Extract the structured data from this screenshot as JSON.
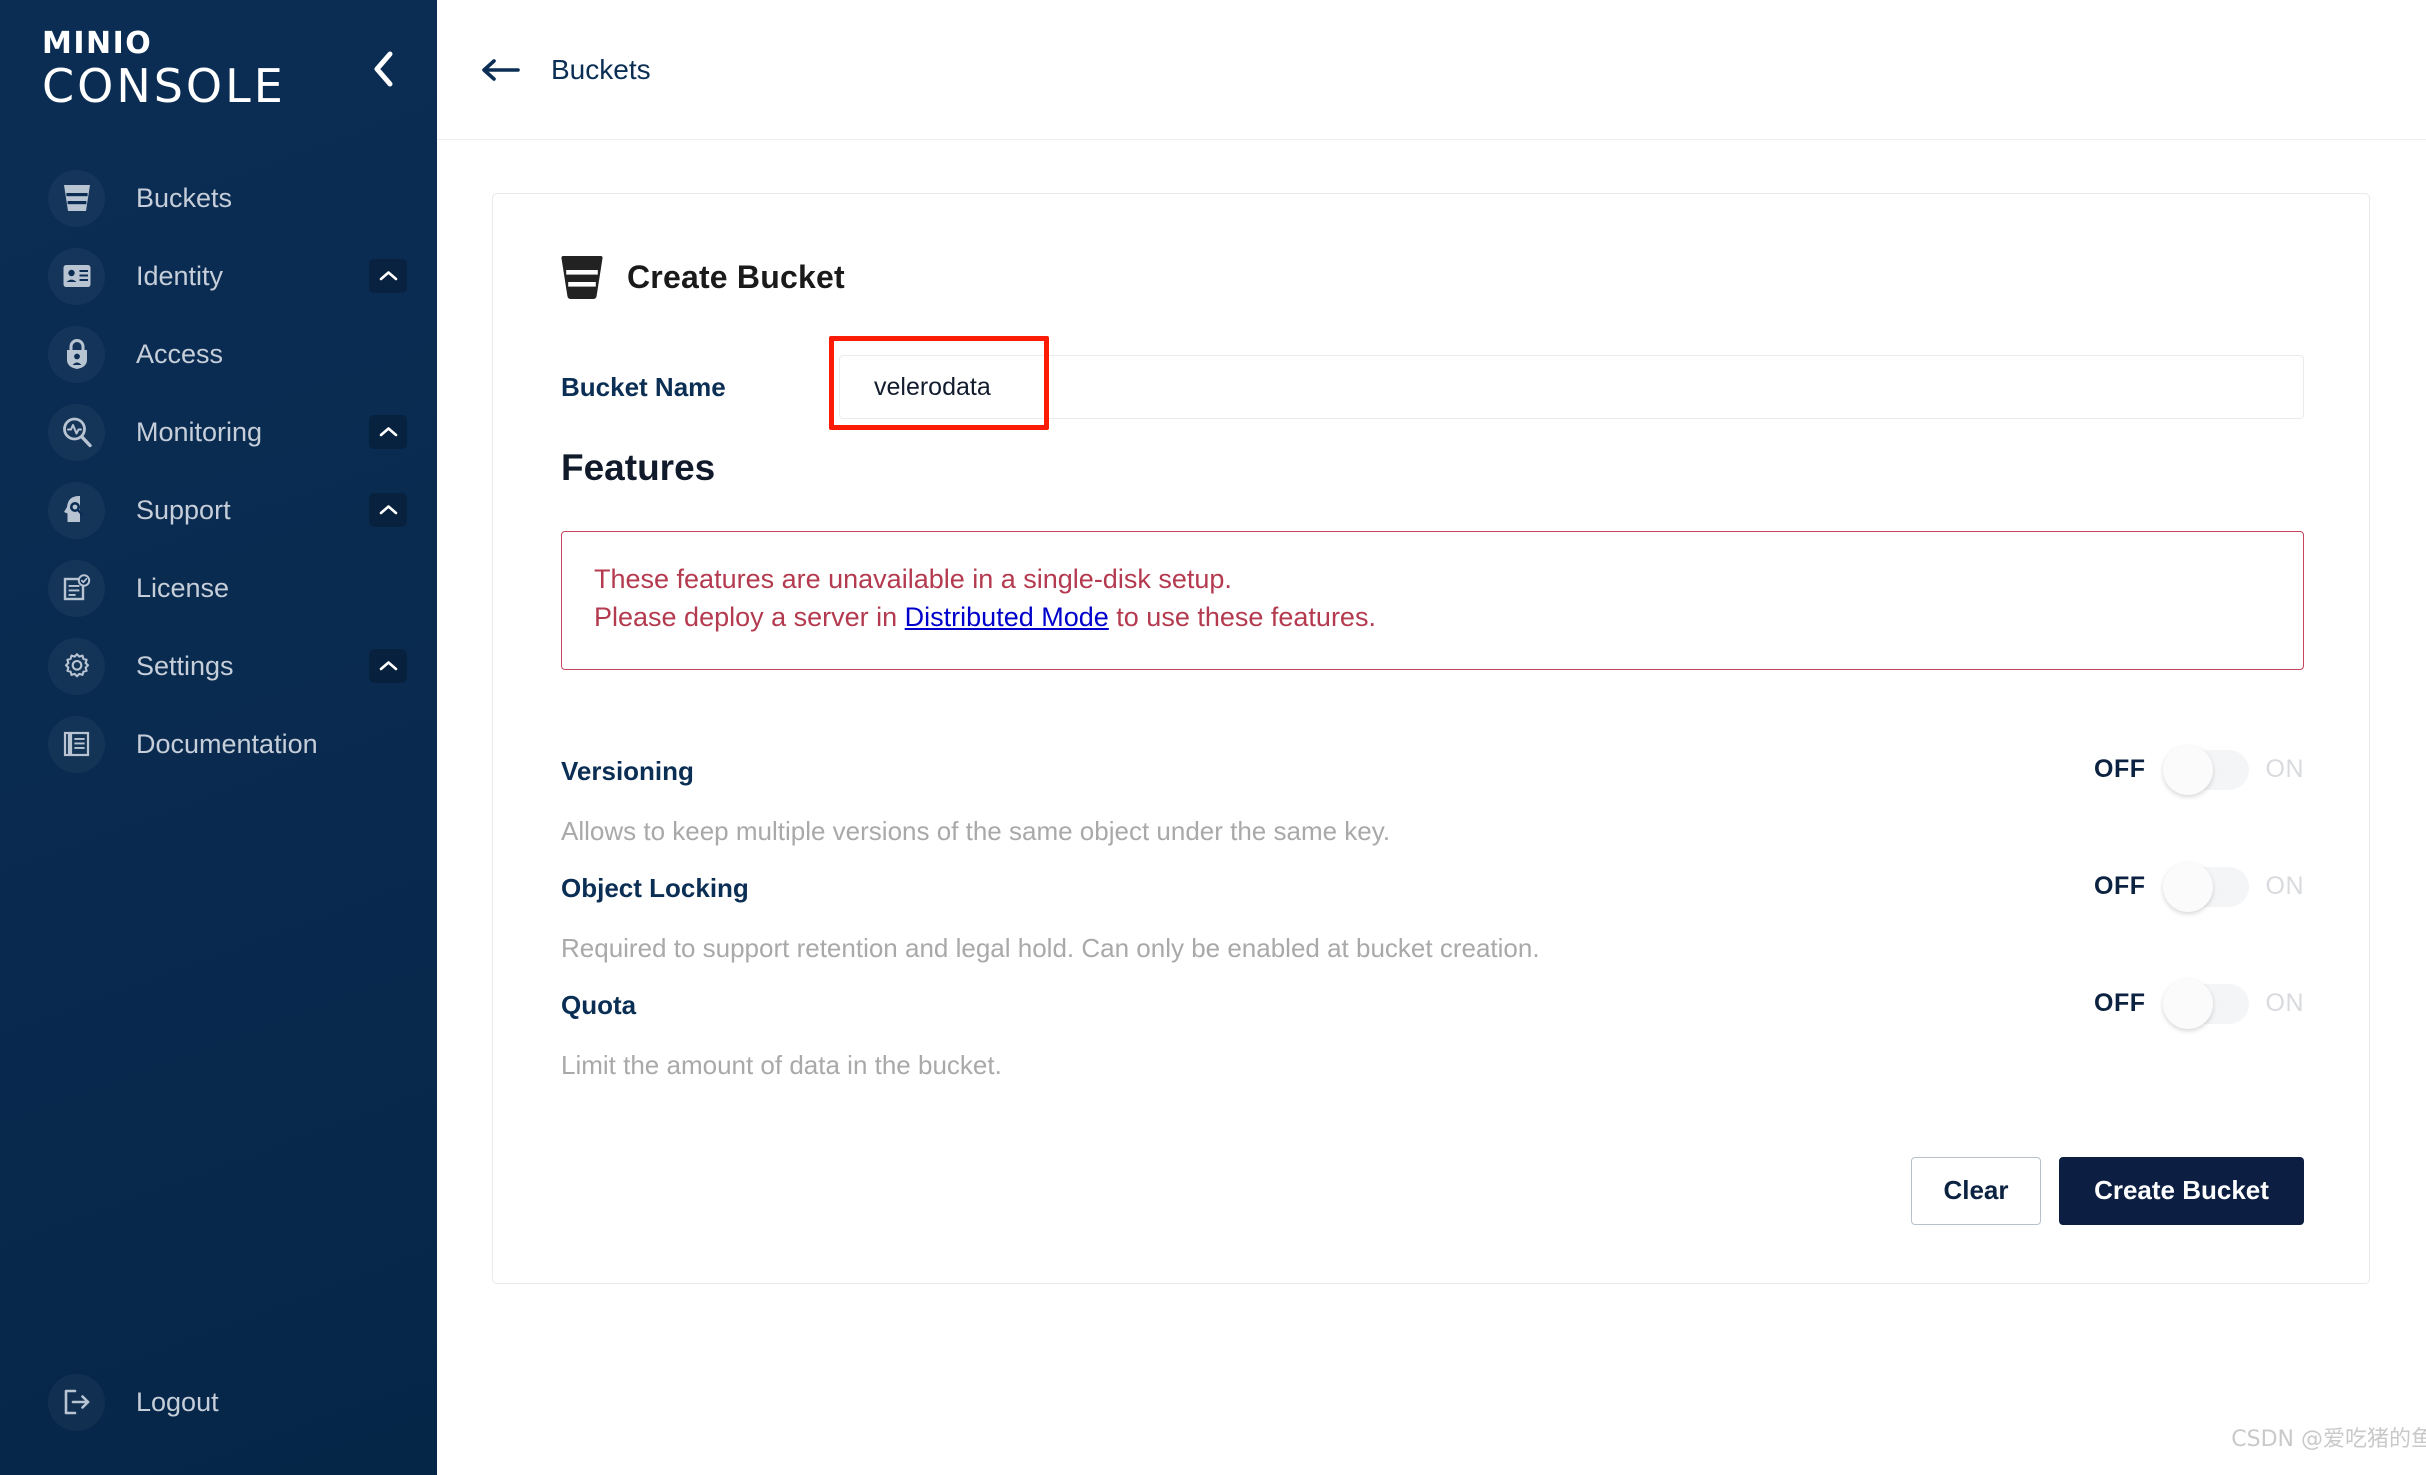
{
  "sidebar": {
    "brand": {
      "minio": "MINIO",
      "console": "CONSOLE"
    },
    "collapse_icon": "chevron-left-icon",
    "items": [
      {
        "label": "Buckets",
        "icon": "bucket-icon",
        "has_chevron": false
      },
      {
        "label": "Identity",
        "icon": "identity-card-icon",
        "has_chevron": true
      },
      {
        "label": "Access",
        "icon": "lock-user-icon",
        "has_chevron": false
      },
      {
        "label": "Monitoring",
        "icon": "magnifier-pulse-icon",
        "has_chevron": true
      },
      {
        "label": "Support",
        "icon": "head-support-icon",
        "has_chevron": true
      },
      {
        "label": "License",
        "icon": "document-check-icon",
        "has_chevron": false
      },
      {
        "label": "Settings",
        "icon": "gear-icon",
        "has_chevron": true
      },
      {
        "label": "Documentation",
        "icon": "book-pages-icon",
        "has_chevron": false
      }
    ],
    "logout": {
      "label": "Logout",
      "icon": "logout-arrow-icon"
    }
  },
  "topbar": {
    "back_icon": "arrow-left-icon",
    "breadcrumb": "Buckets"
  },
  "card": {
    "title": "Create Bucket",
    "title_icon": "bucket-icon",
    "bucket_name": {
      "label": "Bucket Name",
      "value": "velerodata",
      "placeholder": ""
    },
    "features_heading": "Features",
    "warning": {
      "line1": "These features are unavailable in a single-disk setup.",
      "line2_before": "Please deploy a server in ",
      "line2_link": "Distributed Mode",
      "line2_after": " to use these features."
    },
    "features": [
      {
        "name": "Versioning",
        "description": "Allows to keep multiple versions of the same object under the same key.",
        "off_label": "OFF",
        "on_label": "ON",
        "state": "off"
      },
      {
        "name": "Object Locking",
        "description": "Required to support retention and legal hold. Can only be enabled at bucket creation.",
        "off_label": "OFF",
        "on_label": "ON",
        "state": "off"
      },
      {
        "name": "Quota",
        "description": "Limit the amount of data in the bucket.",
        "off_label": "OFF",
        "on_label": "ON",
        "state": "off"
      }
    ],
    "buttons": {
      "clear": "Clear",
      "create": "Create Bucket"
    }
  },
  "watermark": "CSDN @爱吃猪的鱼",
  "colors": {
    "sidebar_top": "#0b2d54",
    "sidebar_bottom": "#062648",
    "accent_navy": "#0c1f42",
    "warning_border": "#c8435e",
    "warning_text": "#b43a4f",
    "link_blue": "#0000cd",
    "annotation_red": "#fc1b05"
  }
}
